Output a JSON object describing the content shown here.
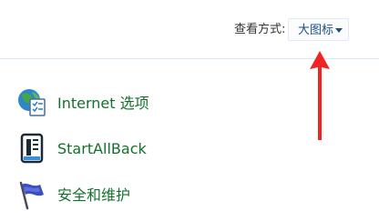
{
  "header": {
    "view_label": "查看方式:",
    "view_value": "大图标"
  },
  "items": [
    {
      "label": "Internet 选项",
      "icon": "internet-options-icon"
    },
    {
      "label": "StartAllBack",
      "icon": "startallback-icon"
    },
    {
      "label": "安全和维护",
      "icon": "security-maintenance-flag-icon"
    }
  ],
  "annotation": {
    "arrow_color": "#f12424",
    "points_to": "view-dropdown"
  },
  "colors": {
    "item_text": "#14702c",
    "dropdown_text": "#1e4f86",
    "header_border": "#dce8f2"
  }
}
